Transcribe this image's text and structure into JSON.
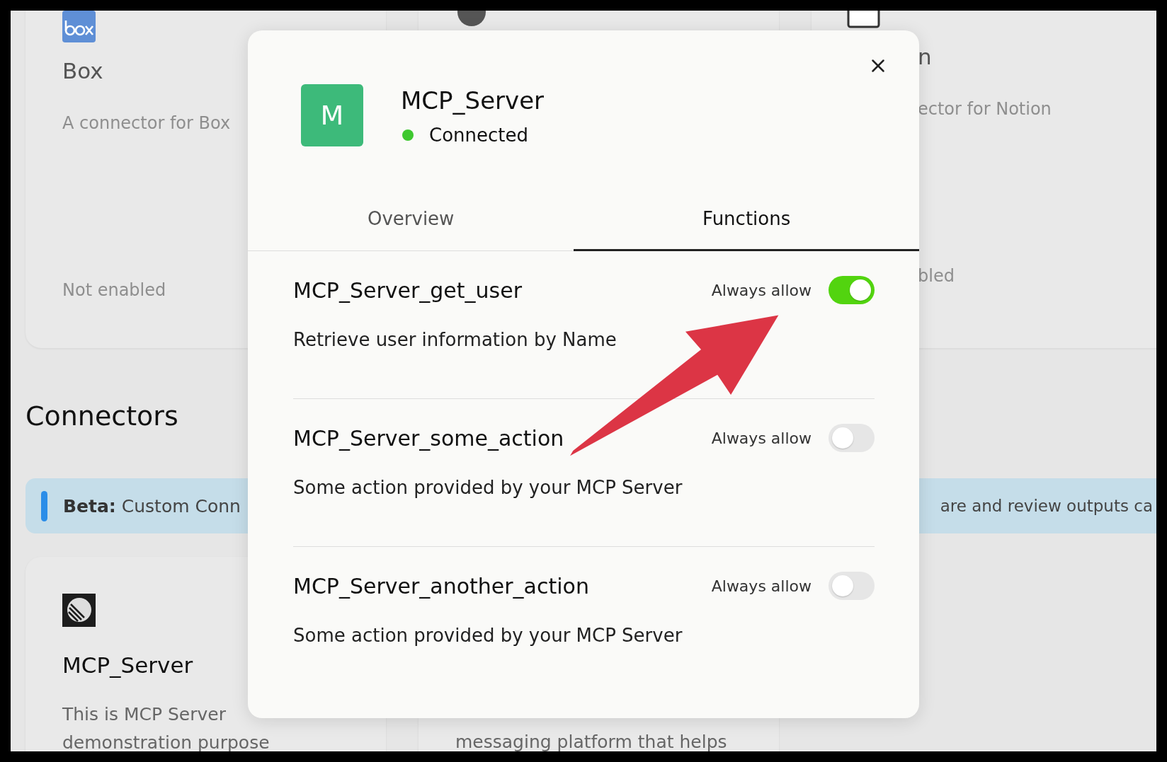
{
  "box_card": {
    "title": "Box",
    "description": "A connector for Box",
    "status": "Not enabled"
  },
  "notion_card": {
    "title": "n",
    "description": "ector for Notion",
    "status": "bled"
  },
  "connectors_heading": "Connectors",
  "beta_banner": {
    "text_left": "**Beta:** Custom Conn",
    "text_right": "are and review outputs ca"
  },
  "mcp_card": {
    "title": "MCP_Server",
    "description_lines": [
      "This is MCP Server",
      "demonstration purpose"
    ]
  },
  "intercom_card": {
    "description": "messaging platform that helps"
  },
  "dialog": {
    "logo_letter": "M",
    "title": "MCP_Server",
    "status": {
      "label": "Connected",
      "connected": true
    },
    "tabs": [
      {
        "label": "Overview",
        "selected": false
      },
      {
        "label": "Functions",
        "selected": true
      }
    ],
    "functions": [
      {
        "name": "MCP_Server_get_user",
        "permission_label": "Always allow",
        "always_allow": true,
        "description": "Retrieve user information by Name"
      },
      {
        "name": "MCP_Server_some_action",
        "permission_label": "Always allow",
        "always_allow": false,
        "description": "Some action provided by your MCP Server"
      },
      {
        "name": "MCP_Server_another_action",
        "permission_label": "Always allow",
        "always_allow": false,
        "description": "Some action provided by your MCP Server"
      }
    ]
  }
}
